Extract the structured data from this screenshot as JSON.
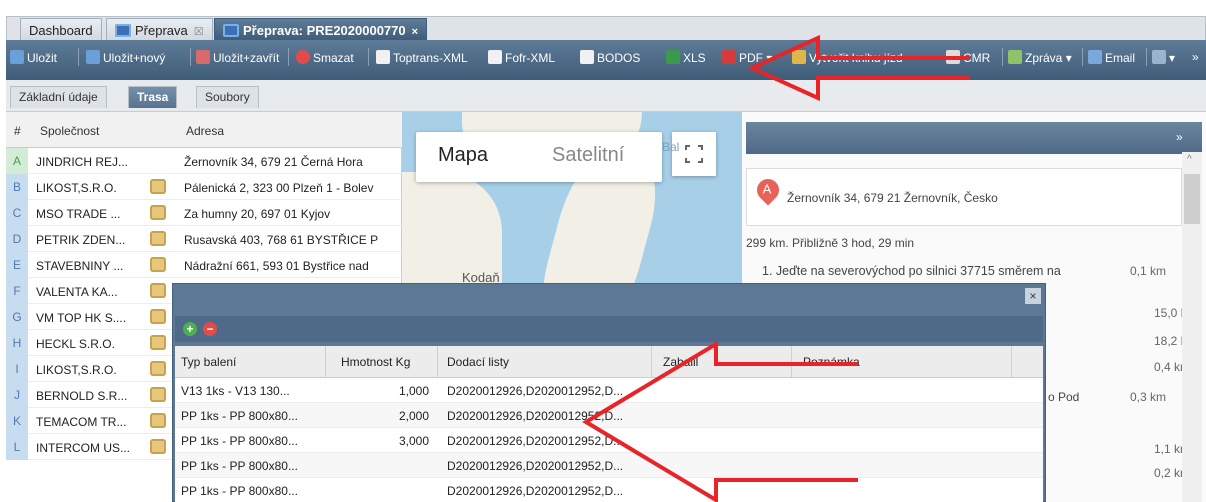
{
  "tabs": [
    {
      "label": "Dashboard"
    },
    {
      "label": "Přeprava",
      "close": "☒"
    },
    {
      "label": "Přeprava: PRE2020000770",
      "close": "×"
    }
  ],
  "toolbar": {
    "save": "Uložit",
    "save_new": "Uložit+nový",
    "save_close": "Uložit+zavřít",
    "delete": "Smazat",
    "toptrans": "Toptrans-XML",
    "fofr": "Fofr-XML",
    "bodos": "BODOS",
    "xls": "XLS",
    "pdf": "PDF",
    "book": "Vytvořit knihu jízd",
    "cmr": "CMR",
    "report": "Zpráva",
    "email": "Email",
    "more": "»"
  },
  "subtabs": [
    "Základní údaje",
    "Trasa",
    "Soubory"
  ],
  "grid": {
    "headers": {
      "num": "#",
      "company": "Společnost",
      "address": "Adresa"
    },
    "rows": [
      {
        "letter": "A",
        "company": "JINDRICH REJ...",
        "address": "Žernovník 34, 679 21 Černá Hora"
      },
      {
        "letter": "B",
        "company": "LIKOST,S.R.O.",
        "address": "Pálenická 2, 323 00 Plzeň 1 - Bolev"
      },
      {
        "letter": "C",
        "company": "MSO TRADE ...",
        "address": "Za humny 20, 697 01 Kyjov"
      },
      {
        "letter": "D",
        "company": "PETRIK ZDEN...",
        "address": "Rusavská 403, 768 61 BYSTŘICE P"
      },
      {
        "letter": "E",
        "company": "STAVEBNINY ...",
        "address": "Nádražní 661, 593 01 Bystřice nad"
      },
      {
        "letter": "F",
        "company": "VALENTA KA...",
        "address": ""
      },
      {
        "letter": "G",
        "company": "VM TOP HK S....",
        "address": ""
      },
      {
        "letter": "H",
        "company": "HECKL S.R.O.",
        "address": ""
      },
      {
        "letter": "I",
        "company": "LIKOST,S.R.O.",
        "address": ""
      },
      {
        "letter": "J",
        "company": "BERNOLD S.R...",
        "address": ""
      },
      {
        "letter": "K",
        "company": "TEMACOM TR...",
        "address": ""
      },
      {
        "letter": "L",
        "company": "INTERCOM US...",
        "address": ""
      }
    ]
  },
  "map": {
    "map_label": "Mapa",
    "satellite_label": "Satelitní",
    "city": "Kodaň",
    "place": "Bal"
  },
  "route": {
    "address": "Žernovník 34, 679 21 Žernovník, Česko",
    "summary": "299 km. Přibližně 3 hod, 29 min",
    "step1": "1.  Jeďte na severovýchod po silnici 37715 směrem na",
    "step1_dist": "0,1 km",
    "distances": [
      "15,0 km",
      "18,2 km",
      "0,4 km",
      "0,3 km",
      "1,1 km",
      "0,2 km"
    ],
    "pod": "o Pod"
  },
  "dialog": {
    "headers": [
      "Typ balení",
      "Hmotnost Kg",
      "Dodací listy",
      "Zabalil",
      "Poznámka"
    ],
    "rows": [
      {
        "typ": "V13 1ks - V13 130...",
        "weight": "1,000",
        "notes": "D2020012926,D2020012952,D..."
      },
      {
        "typ": "PP 1ks - PP 800x80...",
        "weight": "2,000",
        "notes": "D2020012926,D2020012952,D..."
      },
      {
        "typ": "PP 1ks - PP 800x80...",
        "weight": "3,000",
        "notes": "D2020012926,D2020012952,D..."
      },
      {
        "typ": "PP 1ks - PP 800x80...",
        "weight": "",
        "notes": "D2020012926,D2020012952,D..."
      },
      {
        "typ": "PP 1ks - PP 800x80...",
        "weight": "",
        "notes": "D2020012926,D2020012952,D..."
      }
    ],
    "add": "+",
    "remove": "−",
    "close": "×"
  },
  "colors": {
    "annotation_arrow": "#e8242a",
    "toolbar": "#4b6885",
    "row_letter_bg": "#c8dcf0"
  }
}
